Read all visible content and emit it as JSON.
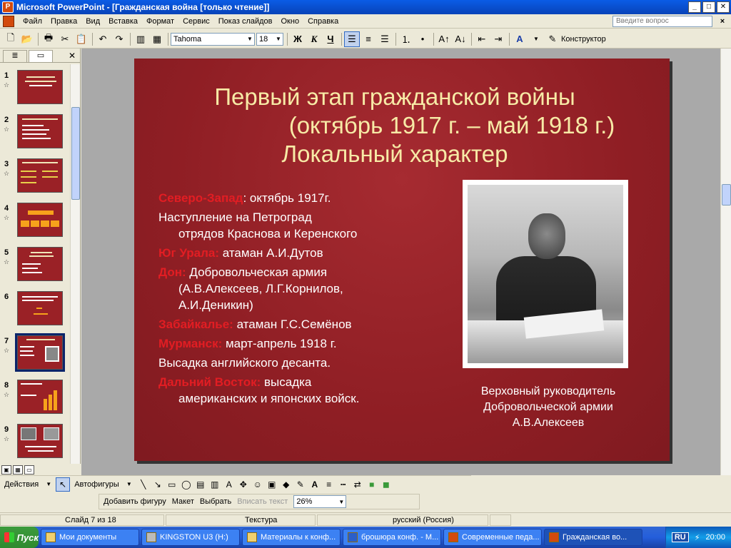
{
  "window": {
    "title": "Microsoft PowerPoint - [Гражданская война [только чтение]]",
    "app_icon": "powerpoint-icon",
    "controls": [
      "minimize",
      "maximize",
      "close"
    ]
  },
  "menu": {
    "items": [
      "Файл",
      "Правка",
      "Вид",
      "Вставка",
      "Формат",
      "Сервис",
      "Показ слайдов",
      "Окно",
      "Справка"
    ],
    "ask_placeholder": "Введите вопрос"
  },
  "toolbar": {
    "font_name": "Tahoma",
    "font_size": "18",
    "bold": "Ж",
    "italic": "К",
    "underline": "Ч",
    "designer": "Конструктор"
  },
  "slides_pane": {
    "numbers": [
      "1",
      "2",
      "3",
      "4",
      "5",
      "6",
      "7",
      "8",
      "9"
    ],
    "selected": "7"
  },
  "slide": {
    "title_line1": "Первый этап гражданской войны",
    "title_line2": "(октябрь 1917 г. – май 1918 г.)",
    "title_line3": "Локальный характер",
    "items": [
      {
        "hl": "Северо-Запад",
        "text": ": октябрь 1917г."
      },
      {
        "hl": "",
        "text": "Наступление на Петроград",
        "cont": "отрядов Краснова и Керенского"
      },
      {
        "hl": "Юг Урала:",
        "text": " атаман А.И.Дутов"
      },
      {
        "hl": "Дон:",
        "text": " Добровольческая армия",
        "cont": "(А.В.Алексеев, Л.Г.Корнилов,",
        "cont2": "А.И.Деникин)"
      },
      {
        "hl": "Забайкалье:",
        "text": " атаман Г.С.Семёнов"
      },
      {
        "hl": "Мурманск:",
        "text": " март-апрель 1918 г."
      },
      {
        "hl": "",
        "text": "Высадка английского десанта."
      },
      {
        "hl": "Дальний Восток:",
        "text": " высадка",
        "cont": "американских и японских войск."
      }
    ],
    "caption_line1": "Верховный руководитель",
    "caption_line2": "Добровольческой армии",
    "caption_line3": "А.В.Алексеев"
  },
  "drawing_toolbar": {
    "actions": "Действия",
    "autoshapes": "Автофигуры"
  },
  "diagram_toolbar": {
    "add_shape": "Добавить фигуру",
    "layout": "Макет",
    "select": "Выбрать",
    "fit_text": "Вписать текст",
    "zoom": "26%"
  },
  "status": {
    "slide": "Слайд 7 из 18",
    "design": "Текстура",
    "language": "русский (Россия)"
  },
  "taskbar": {
    "start": "Пуск",
    "tasks": [
      "Мои документы",
      "KINGSTON U3 (H:)",
      "Материалы к конф...",
      "брошюра конф. - М...",
      "Современные педа...",
      "Гражданская во..."
    ],
    "lang": "RU",
    "clock": "20:00"
  }
}
